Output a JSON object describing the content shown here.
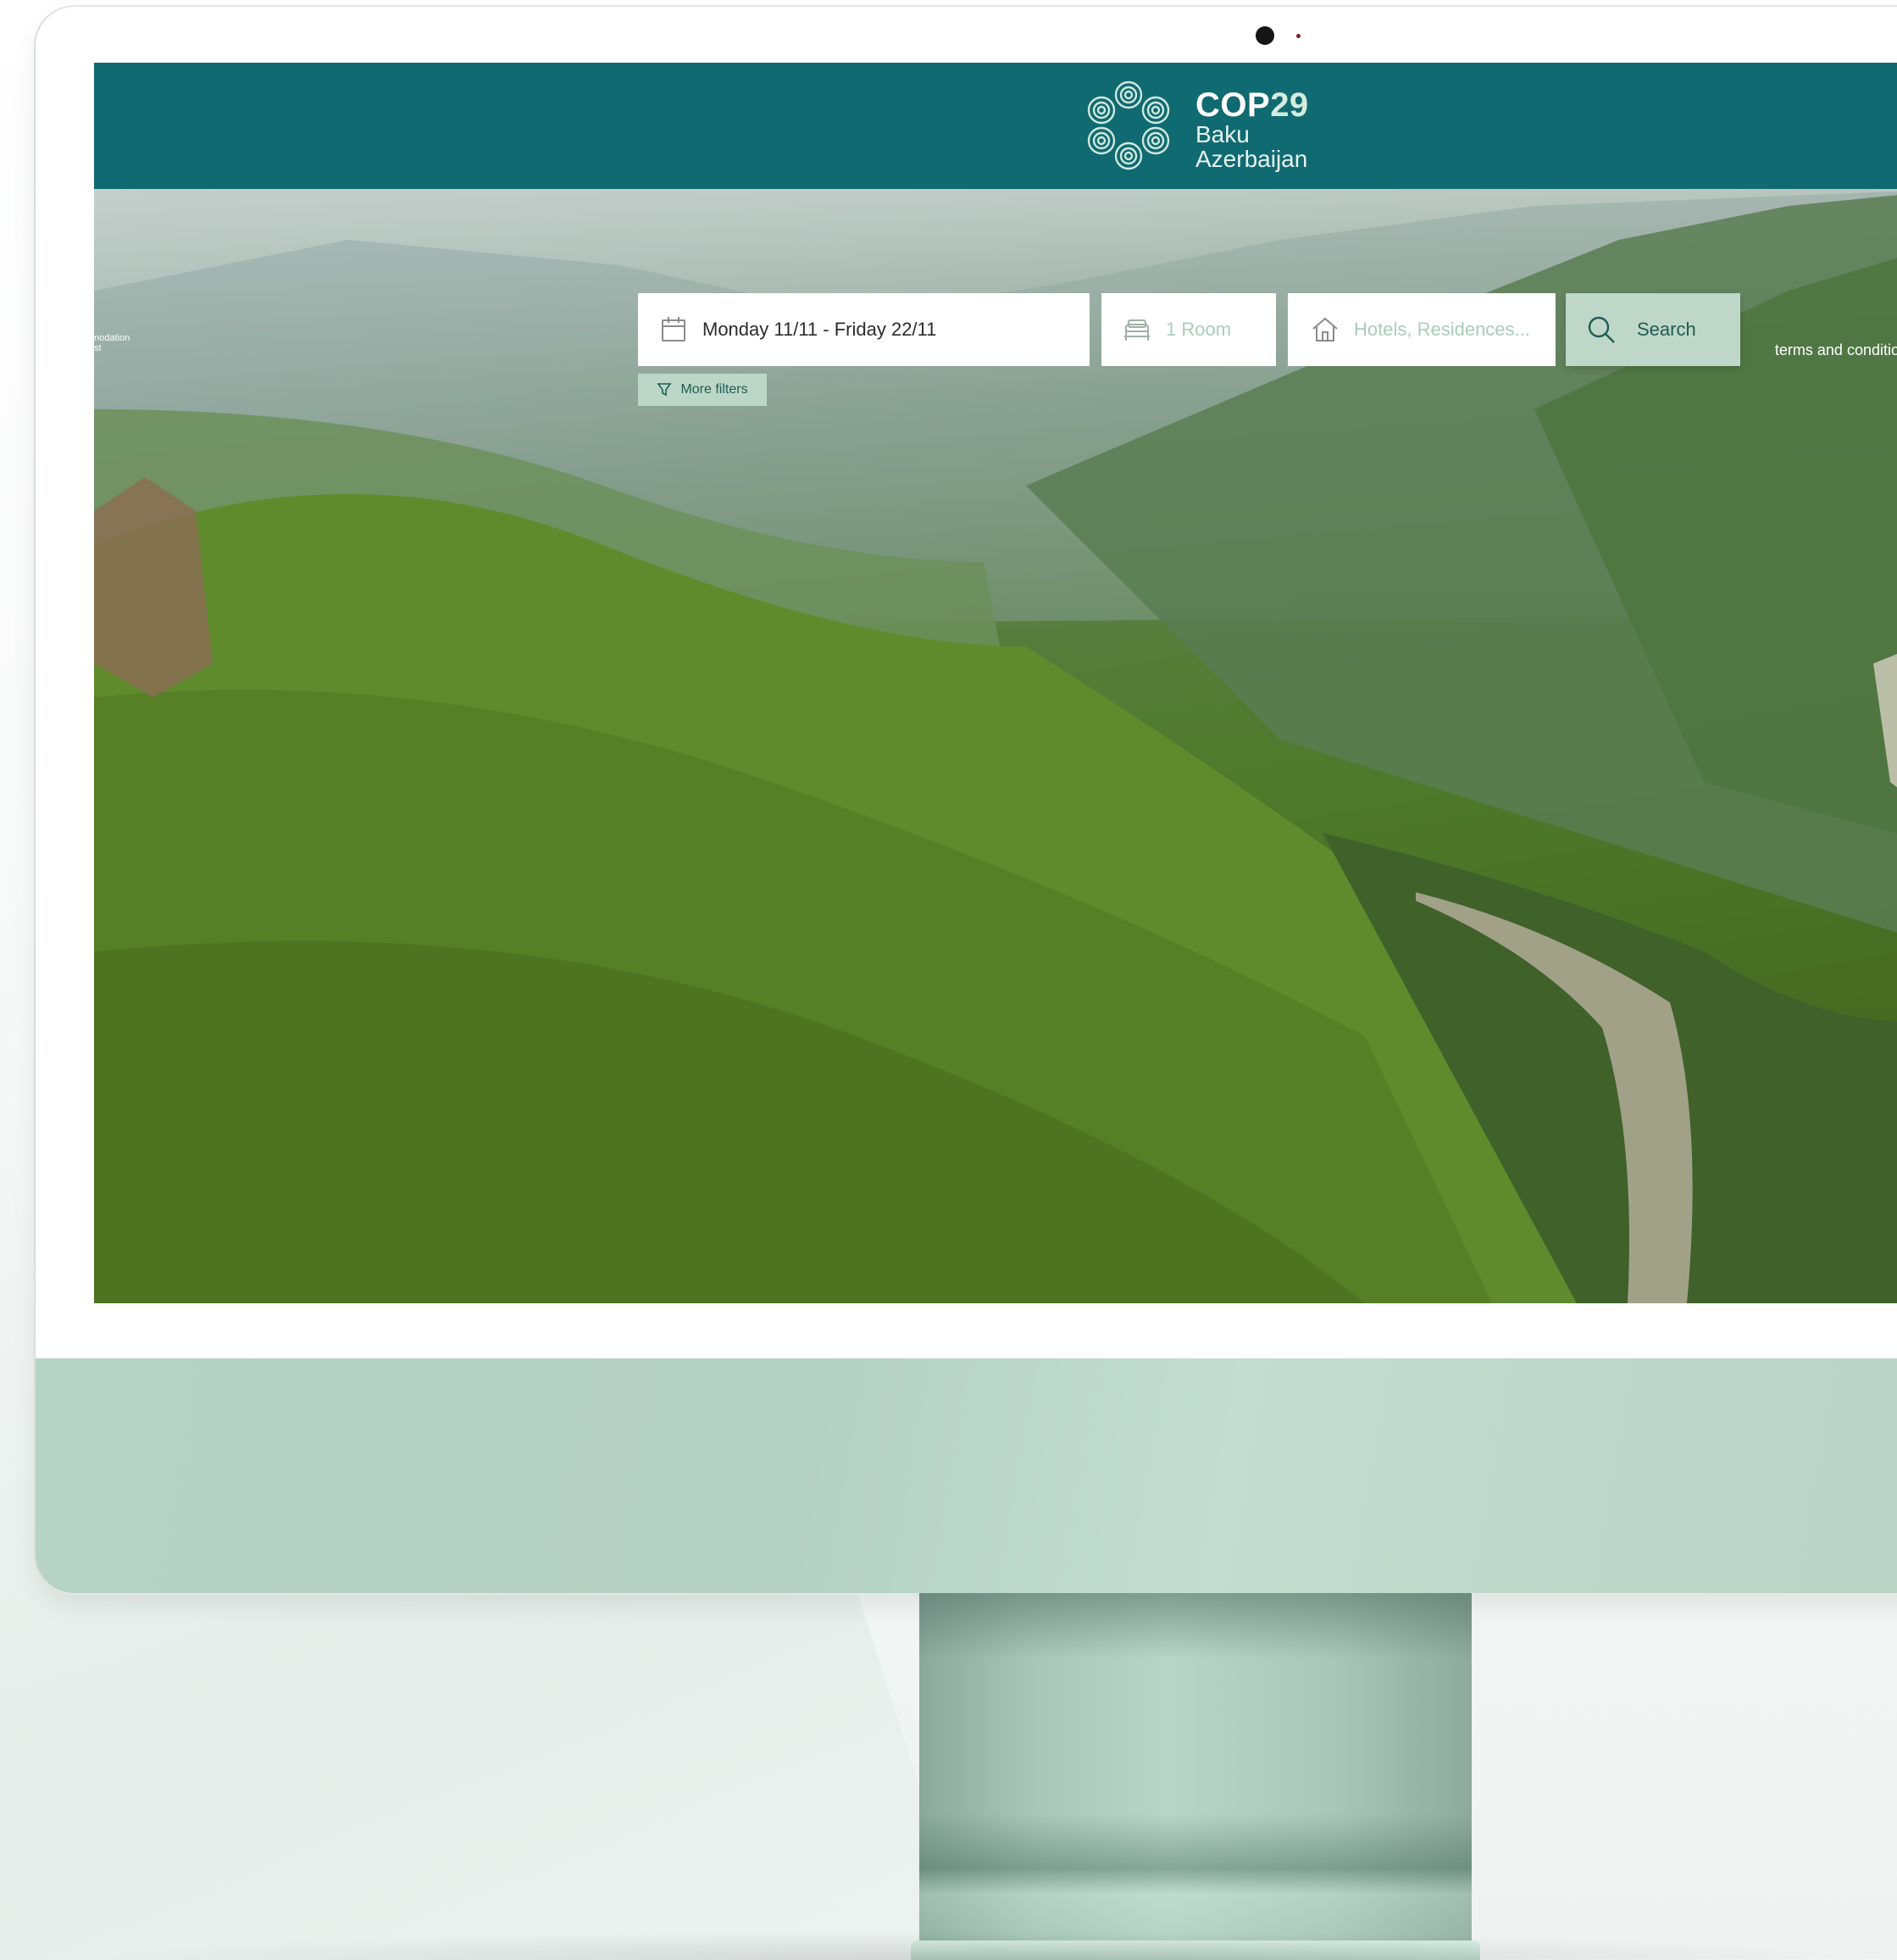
{
  "header": {
    "logo": {
      "title_prefix": "COP",
      "title_number": "29",
      "city": "Baku",
      "country": "Azerbaijan",
      "emblem_icon": "cop29-flower-emblem-icon"
    }
  },
  "hero": {
    "side_tab_line1": "nodation",
    "side_tab_line2": "st",
    "terms_link": "terms and conditions"
  },
  "search": {
    "dates": {
      "icon": "calendar-icon",
      "value": "Monday 11/11 - Friday 22/11"
    },
    "rooms": {
      "icon": "bed-icon",
      "placeholder": "1 Room"
    },
    "property_type": {
      "icon": "house-icon",
      "placeholder": "Hotels, Residences..."
    },
    "button": {
      "icon": "search-icon",
      "label": "Search"
    },
    "more_filters": {
      "icon": "filter-funnel-icon",
      "label": "More filters"
    }
  },
  "colors": {
    "header_bg": "#106a72",
    "accent_light": "#bfd7c8",
    "accent_text": "#1f5c55",
    "placeholder_text": "#a9cdb9",
    "monitor_chin": "#b7d2c6"
  }
}
